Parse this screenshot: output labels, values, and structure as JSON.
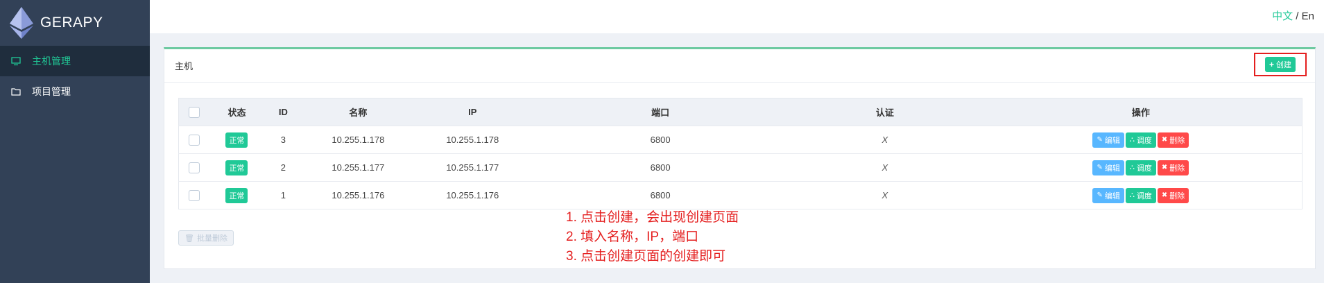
{
  "brand": {
    "name": "GERAPY"
  },
  "sidebar": {
    "items": [
      {
        "label": "主机管理",
        "icon": "monitor-icon",
        "active": true
      },
      {
        "label": "项目管理",
        "icon": "folder-icon",
        "active": false
      }
    ]
  },
  "header": {
    "lang_zh": "中文",
    "lang_sep": " / ",
    "lang_en": "En"
  },
  "panel": {
    "title": "主机",
    "create_label": "创建"
  },
  "table": {
    "columns": [
      "状态",
      "ID",
      "名称",
      "IP",
      "端口",
      "认证",
      "操作"
    ],
    "rows": [
      {
        "status": "正常",
        "id": "3",
        "name": "10.255.1.178",
        "ip": "10.255.1.178",
        "port": "6800",
        "auth": "X"
      },
      {
        "status": "正常",
        "id": "2",
        "name": "10.255.1.177",
        "ip": "10.255.1.177",
        "port": "6800",
        "auth": "X"
      },
      {
        "status": "正常",
        "id": "1",
        "name": "10.255.1.176",
        "ip": "10.255.1.176",
        "port": "6800",
        "auth": "X"
      }
    ],
    "actions": {
      "edit": "编辑",
      "schedule": "调度",
      "delete": "删除"
    }
  },
  "batch_delete_label": "批量删除",
  "annotations": [
    "1. 点击创建，会出现创建页面",
    "2. 填入名称，IP，端口",
    "3. 点击创建页面的创建即可"
  ],
  "colors": {
    "accent": "#20c997",
    "sidebar_bg": "#324157",
    "sidebar_active_bg": "#1f2d3d",
    "edit": "#58b7ff",
    "delete": "#ff4949",
    "annotation": "#e41e1e"
  }
}
